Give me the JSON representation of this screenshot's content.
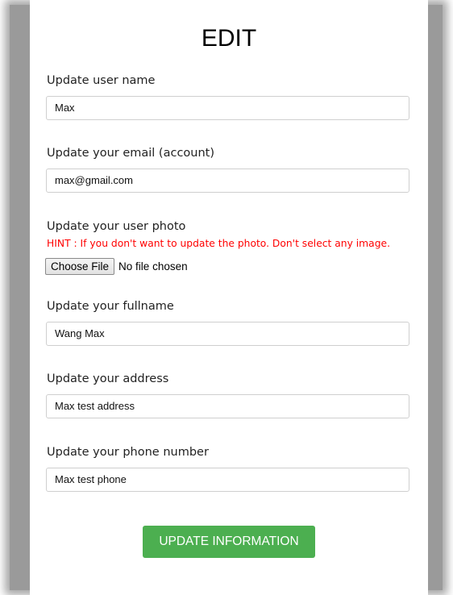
{
  "page": {
    "title": "EDIT"
  },
  "form": {
    "username": {
      "label": "Update user name",
      "value": "Max"
    },
    "email": {
      "label": "Update your email (account)",
      "value": "max@gmail.com"
    },
    "photo": {
      "label": "Update your user photo",
      "hint": "HINT : If you don't want to update the photo. Don't select any image.",
      "button_label": "Choose File",
      "status": "No file chosen"
    },
    "fullname": {
      "label": "Update your fullname",
      "value": "Wang Max"
    },
    "address": {
      "label": "Update your address",
      "value": "Max test address"
    },
    "phone": {
      "label": "Update your phone number",
      "value": "Max test phone"
    },
    "submit_label": "UPDATE INFORMATION"
  },
  "colors": {
    "hint": "#ff0000",
    "submit_background": "#4caf50",
    "submit_text": "#ffffff"
  }
}
